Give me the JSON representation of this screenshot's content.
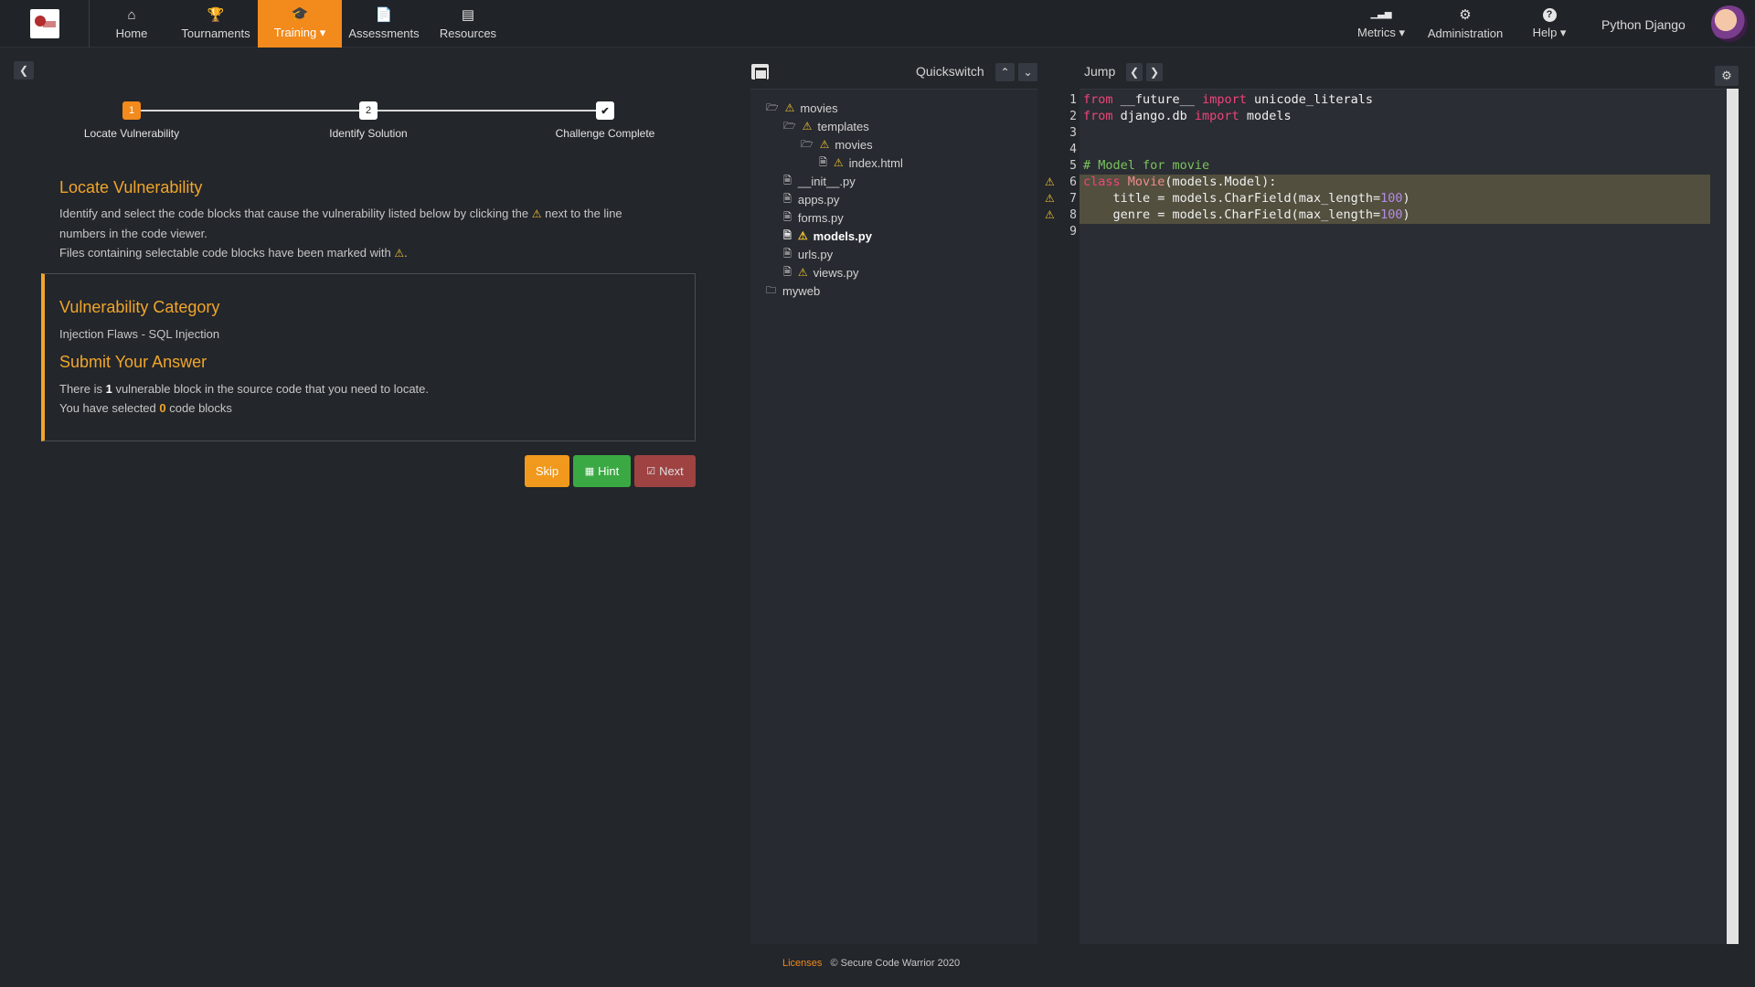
{
  "nav": {
    "items": [
      {
        "label": "Home",
        "icon": "home-icon",
        "glyph": "⌂"
      },
      {
        "label": "Tournaments",
        "icon": "trophy-icon",
        "glyph": "🏆"
      },
      {
        "label": "Training ▾",
        "icon": "graduation-cap-icon",
        "glyph": "🎓"
      },
      {
        "label": "Assessments",
        "icon": "document-icon",
        "glyph": "📄"
      },
      {
        "label": "Resources",
        "icon": "presentation-icon",
        "glyph": "▤"
      }
    ],
    "right_items": [
      {
        "label": "Metrics ▾",
        "icon": "bar-chart-icon",
        "glyph": "▁▃▅"
      },
      {
        "label": "Administration",
        "icon": "gear-icon",
        "glyph": "⚙"
      },
      {
        "label": "Help ▾",
        "icon": "help-icon",
        "glyph": "?"
      }
    ],
    "user_name": "Python Django",
    "active_color": "#f28a1c"
  },
  "stepper": {
    "steps": [
      {
        "number": "1",
        "label": "Locate Vulnerability"
      },
      {
        "number": "2",
        "label": "Identify Solution"
      },
      {
        "number": "✔",
        "label": "Challenge Complete"
      }
    ]
  },
  "locate": {
    "title": "Locate Vulnerability",
    "line1_a": "Identify and select the code blocks that cause the vulnerability listed below by clicking the",
    "line1_b": "next to the line",
    "line2": "numbers in the code viewer.",
    "line3": "Files containing selectable code blocks have been marked with",
    "line3_end": "."
  },
  "vuln": {
    "category_title": "Vulnerability Category",
    "category": "Injection Flaws - SQL Injection",
    "submit_title": "Submit Your Answer",
    "text_a": "There is",
    "count": "1",
    "text_b": "vulnerable block in the source code that you need to locate.",
    "selected_a": "You have selected",
    "selected_count": "0",
    "selected_b": "code blocks"
  },
  "buttons": {
    "skip": "Skip",
    "hint": "Hint",
    "next": "Next"
  },
  "toolbar": {
    "quickswitch": "Quickswitch",
    "jump": "Jump"
  },
  "tree": [
    {
      "name": "movies",
      "type": "folder",
      "warn": true
    },
    {
      "name": "templates",
      "type": "folder",
      "warn": true
    },
    {
      "name": "movies",
      "type": "folder",
      "warn": true
    },
    {
      "name": "index.html",
      "type": "file",
      "warn": true
    },
    {
      "name": "__init__.py",
      "type": "file",
      "warn": false
    },
    {
      "name": "apps.py",
      "type": "file",
      "warn": false
    },
    {
      "name": "forms.py",
      "type": "file",
      "warn": false
    },
    {
      "name": "models.py",
      "type": "file",
      "warn": true,
      "selected": true
    },
    {
      "name": "urls.py",
      "type": "file",
      "warn": false
    },
    {
      "name": "views.py",
      "type": "file",
      "warn": true
    },
    {
      "name": "myweb",
      "type": "folder",
      "warn": false
    }
  ],
  "code": {
    "line_numbers": [
      "1",
      "2",
      "3",
      "4",
      "5",
      "6",
      "7",
      "8",
      "9"
    ],
    "l1_kw1": "from",
    "l1_a": " __future__ ",
    "l1_kw2": "import",
    "l1_b": " unicode_literals",
    "l2_kw1": "from",
    "l2_a": " django.db ",
    "l2_kw2": "import",
    "l2_b": " models",
    "l5_comment": "# Model for movie",
    "l6_kw": "class",
    "l6_cls": " Movie",
    "l6_rest": "(models.Model):",
    "l7_a": "    title = models.CharField(max_length=",
    "l7_num": "100",
    "l7_b": ")",
    "l8_a": "    genre = models.CharField(max_length=",
    "l8_num": "100",
    "l8_b": ")"
  },
  "footer": {
    "licenses": "Licenses",
    "copyright": "© Secure Code Warrior 2020"
  }
}
